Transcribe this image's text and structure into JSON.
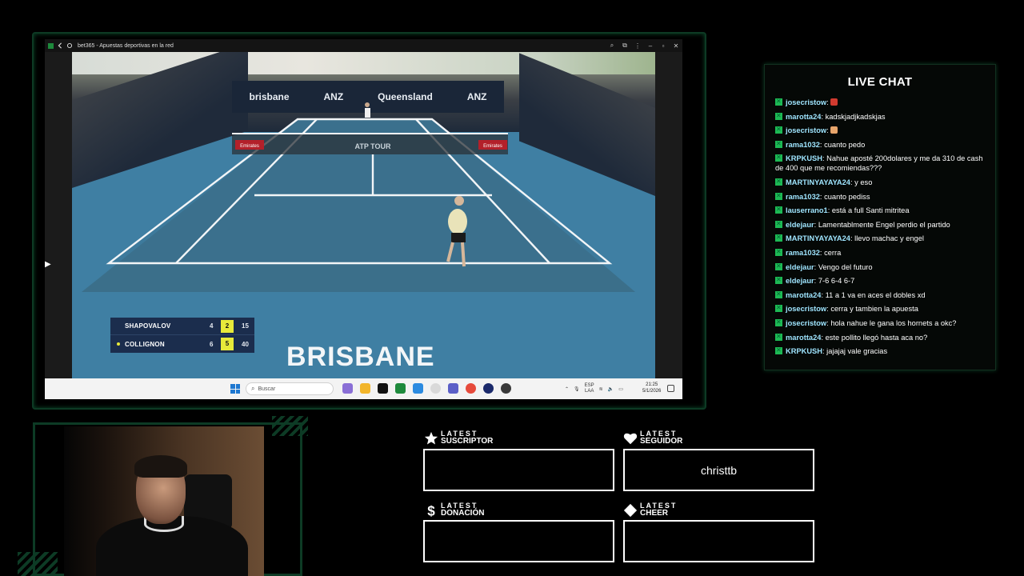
{
  "browser": {
    "title": "bet365 - Apuestas deportivas en la red"
  },
  "broadcast": {
    "ad_wall": [
      "brisbane",
      "ANZ",
      "Queensland",
      "ANZ"
    ],
    "net_banner_left": "Emirates",
    "net_banner_center": "ATP TOUR",
    "net_banner_right": "Emirates",
    "scoreboard": {
      "player1": {
        "name": "SHAPOVALOV",
        "sets": "4",
        "games": "2",
        "points": "15"
      },
      "player2": {
        "name": "COLLIGNON",
        "sets": "6",
        "games": "5",
        "points": "40"
      }
    },
    "venue_text": "BRISBANE"
  },
  "taskbar": {
    "search_placeholder": "Buscar",
    "lang_line1": "ESP",
    "lang_line2": "LAA",
    "time": "21:25",
    "date": "5/1/2026"
  },
  "chat": {
    "title": "LIVE CHAT",
    "messages": [
      {
        "user": "josecristow",
        "text": "",
        "emoji": "red-flag-emoji"
      },
      {
        "user": "marotta24",
        "text": "kadskjadjkadskjas"
      },
      {
        "user": "josecristow",
        "text": "",
        "emoji": "hand-emoji"
      },
      {
        "user": "rama1032",
        "text": "cuanto pedo"
      },
      {
        "user": "KRPKUSH",
        "text": "Nahue aposté 200dolares y me da 310 de cash de 400 que me recomiendas???"
      },
      {
        "user": "MARTINYAYAYA24",
        "text": "y eso"
      },
      {
        "user": "rama1032",
        "text": "cuanto pediss"
      },
      {
        "user": "lauserrano1",
        "text": "está a full Santi mitritea"
      },
      {
        "user": "eldejaur",
        "text": "Lamentablmente Engel perdio el partido"
      },
      {
        "user": "MARTINYAYAYA24",
        "text": "llevo machac y engel"
      },
      {
        "user": "rama1032",
        "text": "cerra"
      },
      {
        "user": "eldejaur",
        "text": "Vengo del futuro"
      },
      {
        "user": "eldejaur",
        "text": "7-6 6-4 6-7"
      },
      {
        "user": "marotta24",
        "text": "11 a 1 va en aces el dobles xd"
      },
      {
        "user": "josecristow",
        "text": "cerra y tambien la apuesta"
      },
      {
        "user": "josecristow",
        "text": "hola nahue le gana los hornets a okc?"
      },
      {
        "user": "marotta24",
        "text": "este pollito llegó hasta aca no?"
      },
      {
        "user": "KRPKUSH",
        "text": "jajajaj vale gracias"
      }
    ]
  },
  "widgets": {
    "subscriber": {
      "top": "LATEST",
      "bottom": "SUSCRIPTOR",
      "value": ""
    },
    "follower": {
      "top": "LATEST",
      "bottom": "SEGUIDOR",
      "value": "christtb"
    },
    "donation": {
      "top": "LATEST",
      "bottom": "DONACIÓN",
      "value": ""
    },
    "cheer": {
      "top": "LATEST",
      "bottom": "CHEER",
      "value": ""
    }
  },
  "colors": {
    "frame_green": "#0d3b25",
    "chat_username": "#9fe5ff",
    "badge_green": "#1db954",
    "court_blue": "#3f7fa3",
    "scoreboard_bg": "#1b2d4d",
    "score_highlight": "#e8ea3a"
  }
}
